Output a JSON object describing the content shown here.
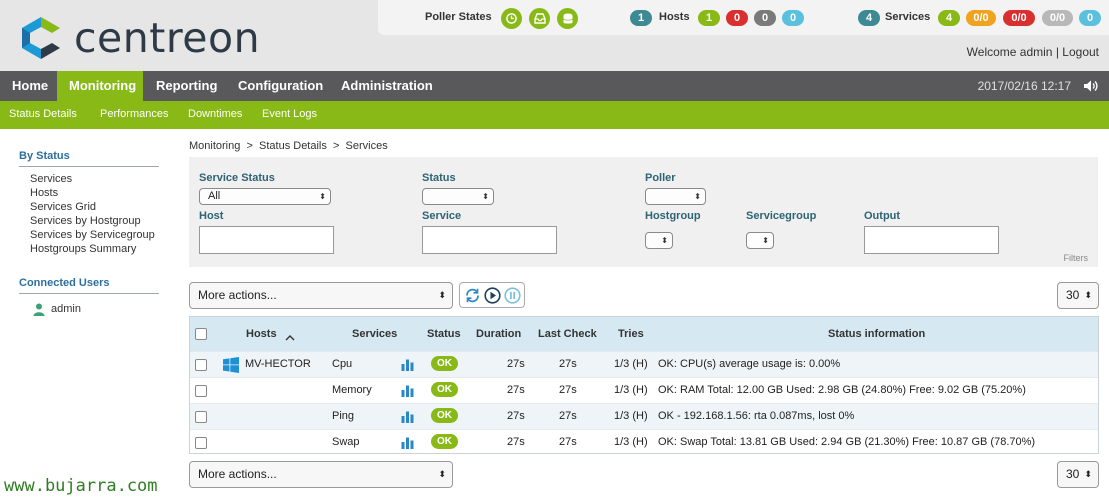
{
  "header": {
    "brand": "centreon",
    "colors": {
      "green": "#88b917",
      "red": "#d9302f",
      "grey": "#7a7a7a",
      "cyan": "#5bc0de",
      "orange": "#f0a31e",
      "teal": "#3d8a95"
    },
    "poller_states_label": "Poller States",
    "poller_icons": [
      "clock-icon",
      "inbox-icon",
      "database-icon"
    ],
    "hosts": {
      "total": "1",
      "label": "Hosts",
      "up": "1",
      "down": "0",
      "unreachable": "0",
      "pending": "0"
    },
    "services": {
      "total": "4",
      "label": "Services",
      "ok": "4",
      "warning": "0/0",
      "critical": "0/0",
      "unknown": "0/0",
      "pending": "0"
    },
    "welcome": "Welcome admin",
    "separator": "|",
    "logout": "Logout"
  },
  "nav": {
    "items": [
      "Home",
      "Monitoring",
      "Reporting",
      "Configuration",
      "Administration"
    ],
    "active": "Monitoring",
    "datetime": "2017/02/16 12:17"
  },
  "subnav": {
    "items": [
      "Status Details",
      "Performances",
      "Downtimes",
      "Event Logs"
    ]
  },
  "sidebar": {
    "by_status_title": "By Status",
    "links": [
      "Services",
      "Hosts",
      "Services Grid",
      "Services by Hostgroup",
      "Services by Servicegroup",
      "Hostgroups Summary"
    ],
    "connected_title": "Connected Users",
    "users": [
      "admin"
    ]
  },
  "breadcrumb": "Monitoring  >  Status Details  >  Services",
  "filters": {
    "service_status_label": "Service Status",
    "service_status_value": "All",
    "status_label": "Status",
    "poller_label": "Poller",
    "host_label": "Host",
    "service_label": "Service",
    "hostgroup_label": "Hostgroup",
    "servicegroup_label": "Servicegroup",
    "output_label": "Output",
    "filters_caption": "Filters"
  },
  "actions": {
    "more_actions": "More actions...",
    "page_size": "30"
  },
  "table": {
    "headers": {
      "hosts": "Hosts",
      "services": "Services",
      "status": "Status",
      "duration": "Duration",
      "last_check": "Last Check",
      "tries": "Tries",
      "status_information": "Status information"
    },
    "rows": [
      {
        "host": "MV-HECTOR",
        "service": "Cpu",
        "status": "OK",
        "duration": "27s",
        "last_check": "27s",
        "tries": "1/3 (H)",
        "info": "OK: CPU(s) average usage is: 0.00%"
      },
      {
        "host": "",
        "service": "Memory",
        "status": "OK",
        "duration": "27s",
        "last_check": "27s",
        "tries": "1/3 (H)",
        "info": "OK: RAM Total: 12.00 GB Used: 2.98 GB (24.80%) Free: 9.02 GB (75.20%)"
      },
      {
        "host": "",
        "service": "Ping",
        "status": "OK",
        "duration": "27s",
        "last_check": "27s",
        "tries": "1/3 (H)",
        "info": "OK - 192.168.1.56: rta 0.087ms, lost 0%"
      },
      {
        "host": "",
        "service": "Swap",
        "status": "OK",
        "duration": "27s",
        "last_check": "27s",
        "tries": "1/3 (H)",
        "info": "OK: Swap Total: 13.81 GB Used: 2.94 GB (21.30%) Free: 10.87 GB (78.70%)"
      }
    ]
  },
  "watermark": "www.bujarra.com"
}
